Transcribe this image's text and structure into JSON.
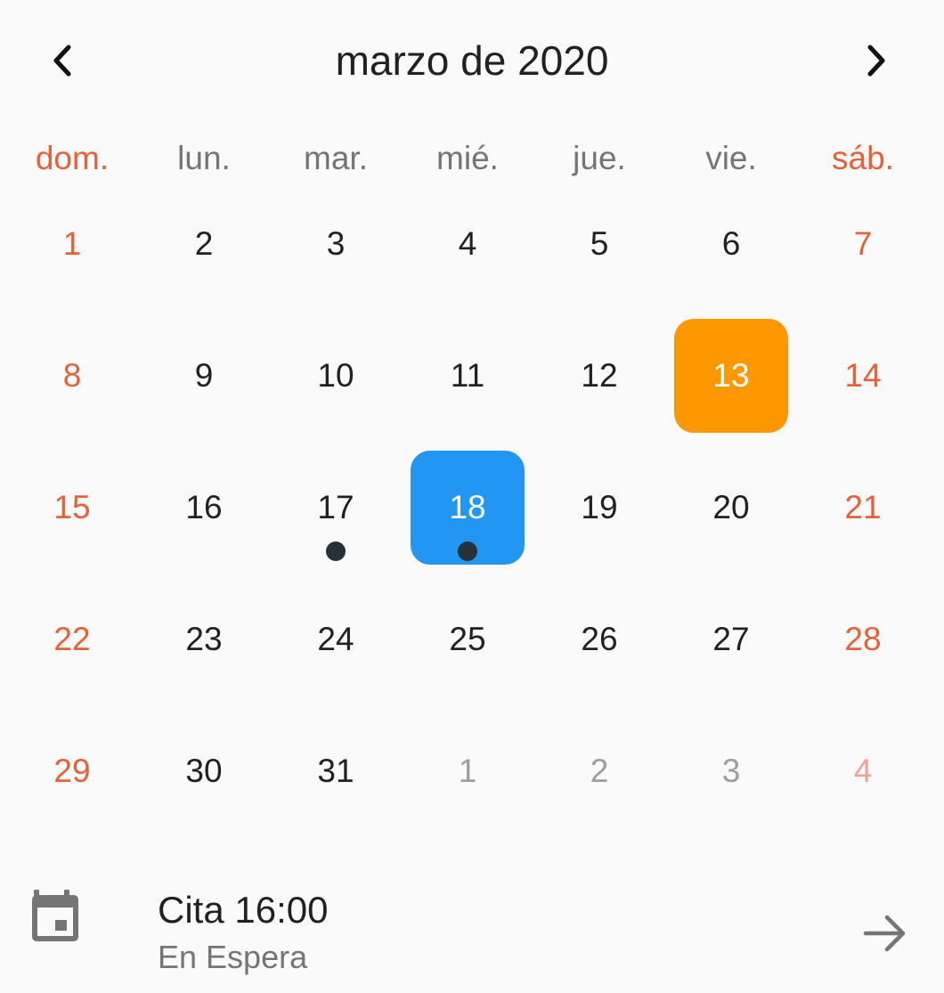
{
  "header": {
    "title": "marzo de 2020",
    "prev_icon": "chevron-left-icon",
    "next_icon": "chevron-right-icon"
  },
  "weekdays": [
    {
      "label": "dom.",
      "weekend": true
    },
    {
      "label": "lun.",
      "weekend": false
    },
    {
      "label": "mar.",
      "weekend": false
    },
    {
      "label": "mié.",
      "weekend": false
    },
    {
      "label": "jue.",
      "weekend": false
    },
    {
      "label": "vie.",
      "weekend": false
    },
    {
      "label": "sáb.",
      "weekend": true
    }
  ],
  "days": [
    {
      "day": "1"
    },
    {
      "day": "2"
    },
    {
      "day": "3"
    },
    {
      "day": "4"
    },
    {
      "day": "5"
    },
    {
      "day": "6"
    },
    {
      "day": "7"
    },
    {
      "day": "8"
    },
    {
      "day": "9"
    },
    {
      "day": "10"
    },
    {
      "day": "11"
    },
    {
      "day": "12"
    },
    {
      "day": "13",
      "state": "today"
    },
    {
      "day": "14"
    },
    {
      "day": "15"
    },
    {
      "day": "16"
    },
    {
      "day": "17",
      "has_event": true
    },
    {
      "day": "18",
      "state": "selected",
      "has_event": true
    },
    {
      "day": "19"
    },
    {
      "day": "20"
    },
    {
      "day": "21"
    },
    {
      "day": "22"
    },
    {
      "day": "23"
    },
    {
      "day": "24"
    },
    {
      "day": "25"
    },
    {
      "day": "26"
    },
    {
      "day": "27"
    },
    {
      "day": "28"
    },
    {
      "day": "29"
    },
    {
      "day": "30"
    },
    {
      "day": "31"
    },
    {
      "day": "1",
      "outside": true
    },
    {
      "day": "2",
      "outside": true
    },
    {
      "day": "3",
      "outside": true
    },
    {
      "day": "4",
      "outside": true
    }
  ],
  "event": {
    "icon": "calendar-icon",
    "title": "Cita 16:00",
    "status": "En Espera",
    "arrow_icon": "arrow-right-icon"
  },
  "colors": {
    "weekend": "#e5613a",
    "today": "#ff9800",
    "selected": "#2196f3",
    "marker": "#263238"
  }
}
